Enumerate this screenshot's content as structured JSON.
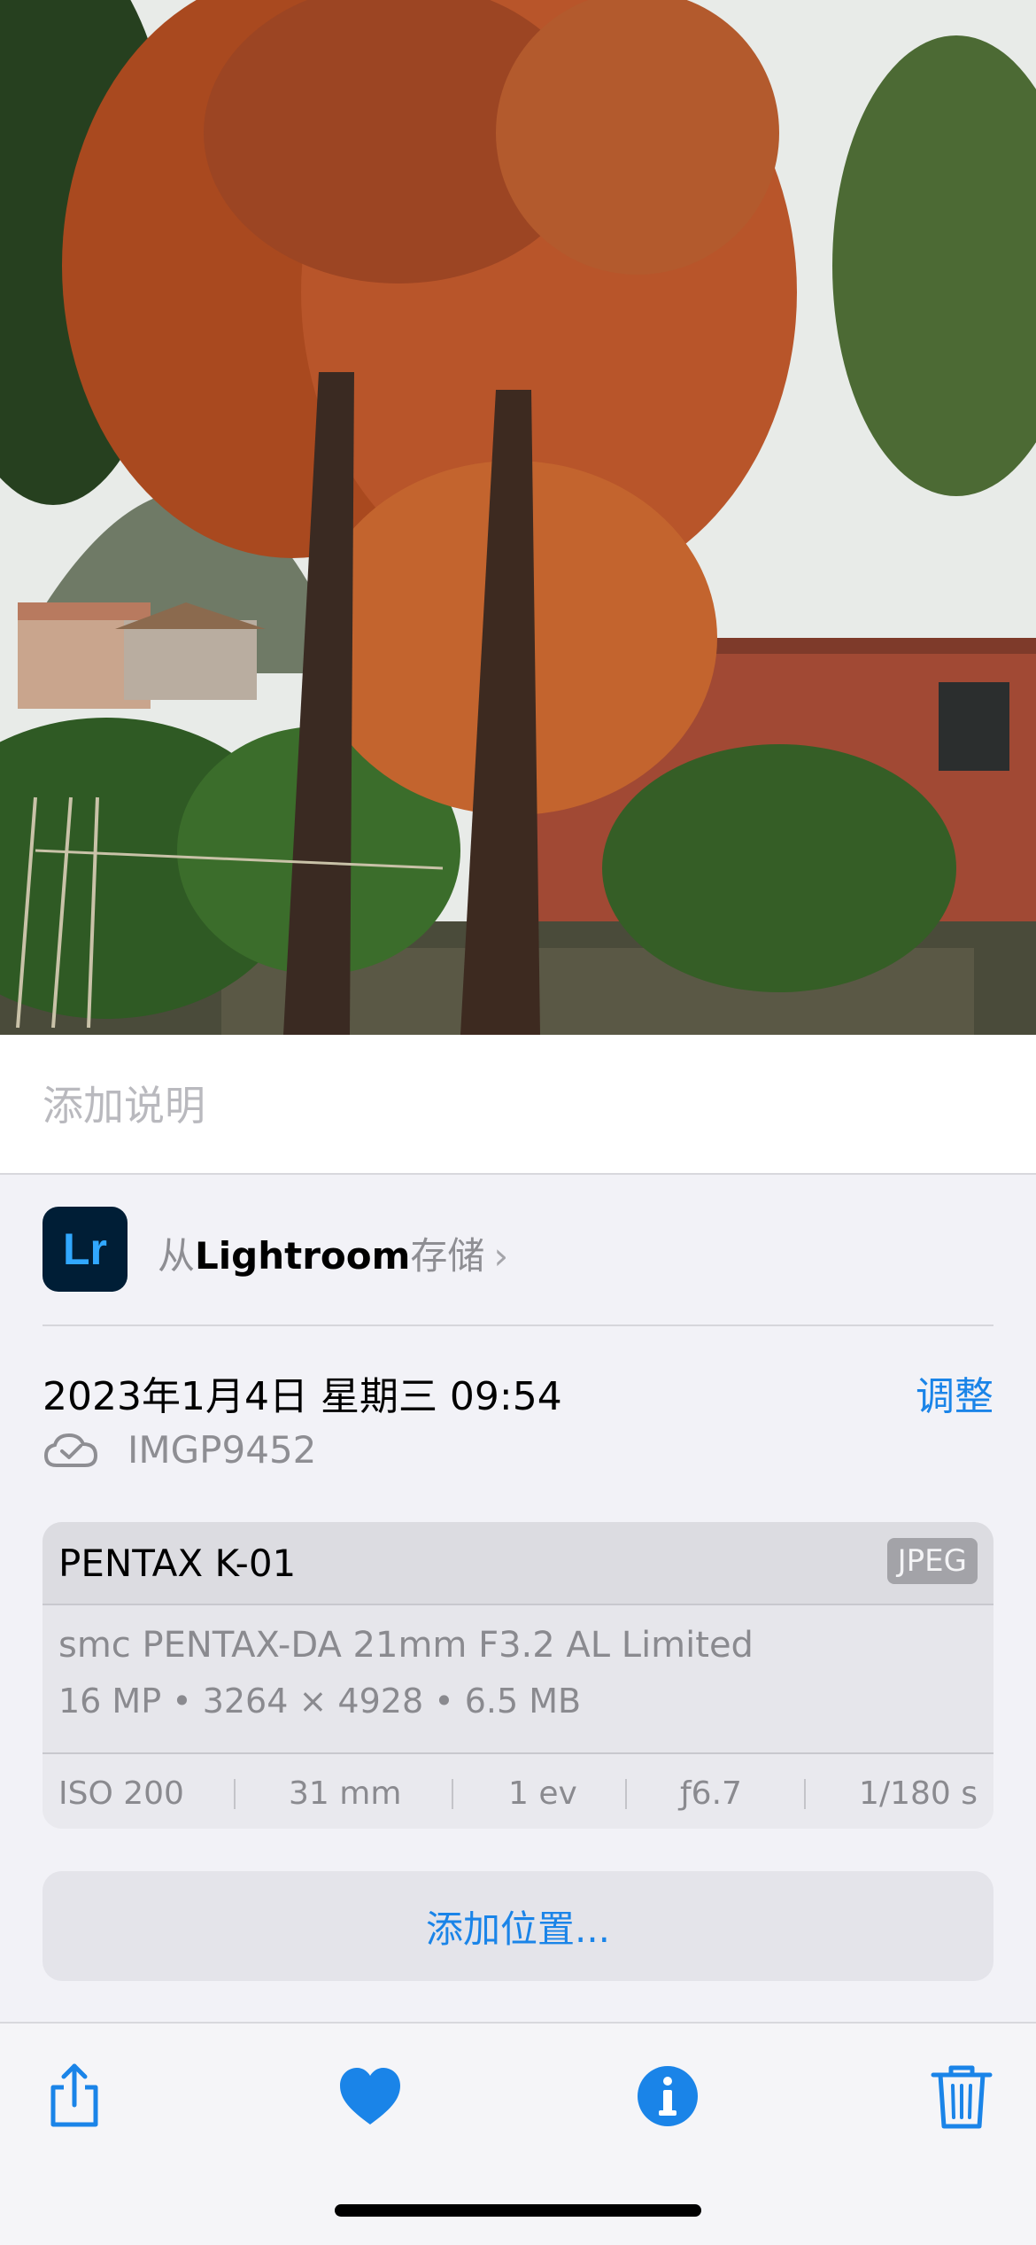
{
  "caption": {
    "placeholder": "添加说明"
  },
  "app_source": {
    "icon_text": "Lr",
    "prefix": "从",
    "app_name": "Lightroom",
    "suffix": "存储",
    "chevron": "›"
  },
  "photo_info": {
    "datetime": "2023年1月4日 星期三 09:54",
    "adjust_label": "调整",
    "filename": "IMGP9452",
    "cloud_icon": "cloud-check-icon"
  },
  "camera": {
    "model": "PENTAX K-01",
    "format": "JPEG",
    "lens": "smc PENTAX-DA 21mm F3.2 AL Limited",
    "specs": "16 MP • 3264 × 4928 • 6.5 MB",
    "exif": {
      "iso": "ISO 200",
      "focal": "31 mm",
      "ev": "1 ev",
      "aperture": "ƒ6.7",
      "shutter": "1/180 s"
    }
  },
  "location": {
    "add_label": "添加位置..."
  },
  "toolbar": {
    "share_icon": "share-icon",
    "favorite_icon": "heart-icon",
    "info_icon": "info-icon",
    "delete_icon": "trash-icon"
  },
  "colors": {
    "accent": "#1a84e8",
    "background": "#f2f2f7"
  }
}
